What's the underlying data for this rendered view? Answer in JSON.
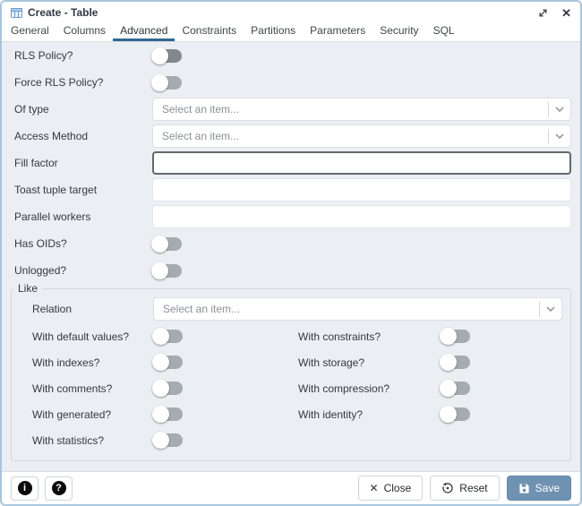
{
  "window": {
    "title": "Create - Table"
  },
  "tabs": {
    "items": [
      {
        "label": "General",
        "active": false
      },
      {
        "label": "Columns",
        "active": false
      },
      {
        "label": "Advanced",
        "active": true
      },
      {
        "label": "Constraints",
        "active": false
      },
      {
        "label": "Partitions",
        "active": false
      },
      {
        "label": "Parameters",
        "active": false
      },
      {
        "label": "Security",
        "active": false
      },
      {
        "label": "SQL",
        "active": false
      }
    ]
  },
  "form": {
    "rows": [
      {
        "id": "rls-policy",
        "type": "toggle",
        "label": "RLS Policy?",
        "on": false,
        "focused": true
      },
      {
        "id": "force-rls-policy",
        "type": "toggle",
        "label": "Force RLS Policy?",
        "on": false
      },
      {
        "id": "of-type",
        "type": "select",
        "label": "Of type",
        "placeholder": "Select an item..."
      },
      {
        "id": "access-method",
        "type": "select",
        "label": "Access Method",
        "placeholder": "Select an item..."
      },
      {
        "id": "fill-factor",
        "type": "input",
        "label": "Fill factor",
        "value": "",
        "focused": true
      },
      {
        "id": "toast-tuple-target",
        "type": "input",
        "label": "Toast tuple target",
        "value": ""
      },
      {
        "id": "parallel-workers",
        "type": "input",
        "label": "Parallel workers",
        "value": ""
      },
      {
        "id": "has-oids",
        "type": "toggle",
        "label": "Has OIDs?",
        "on": false
      },
      {
        "id": "unlogged",
        "type": "toggle",
        "label": "Unlogged?",
        "on": false
      }
    ]
  },
  "like": {
    "legend": "Like",
    "relation": {
      "id": "relation",
      "label": "Relation",
      "placeholder": "Select an item..."
    },
    "toggle_rows": [
      {
        "left": {
          "id": "with-default-values",
          "label": "With default values?",
          "on": false
        },
        "right": {
          "id": "with-constraints",
          "label": "With constraints?",
          "on": false
        }
      },
      {
        "left": {
          "id": "with-indexes",
          "label": "With indexes?",
          "on": false
        },
        "right": {
          "id": "with-storage",
          "label": "With storage?",
          "on": false
        }
      },
      {
        "left": {
          "id": "with-comments",
          "label": "With comments?",
          "on": false
        },
        "right": {
          "id": "with-compression",
          "label": "With compression?",
          "on": false
        }
      },
      {
        "left": {
          "id": "with-generated",
          "label": "With generated?",
          "on": false
        },
        "right": {
          "id": "with-identity",
          "label": "With identity?",
          "on": false
        }
      },
      {
        "left": {
          "id": "with-statistics",
          "label": "With statistics?",
          "on": false
        },
        "right": null
      }
    ]
  },
  "footer": {
    "info_glyph": "i",
    "help_glyph": "?",
    "close_label": "Close",
    "reset_label": "Reset",
    "save_label": "Save",
    "close_glyph": "✕"
  },
  "colors": {
    "accent": "#2e6793",
    "save_button": "#7092b2",
    "dialog_border": "#a9c4da",
    "content_bg": "#ebeef2",
    "toggle_track_off": "#a6abb0",
    "toggle_track_focused": "#83888d"
  }
}
